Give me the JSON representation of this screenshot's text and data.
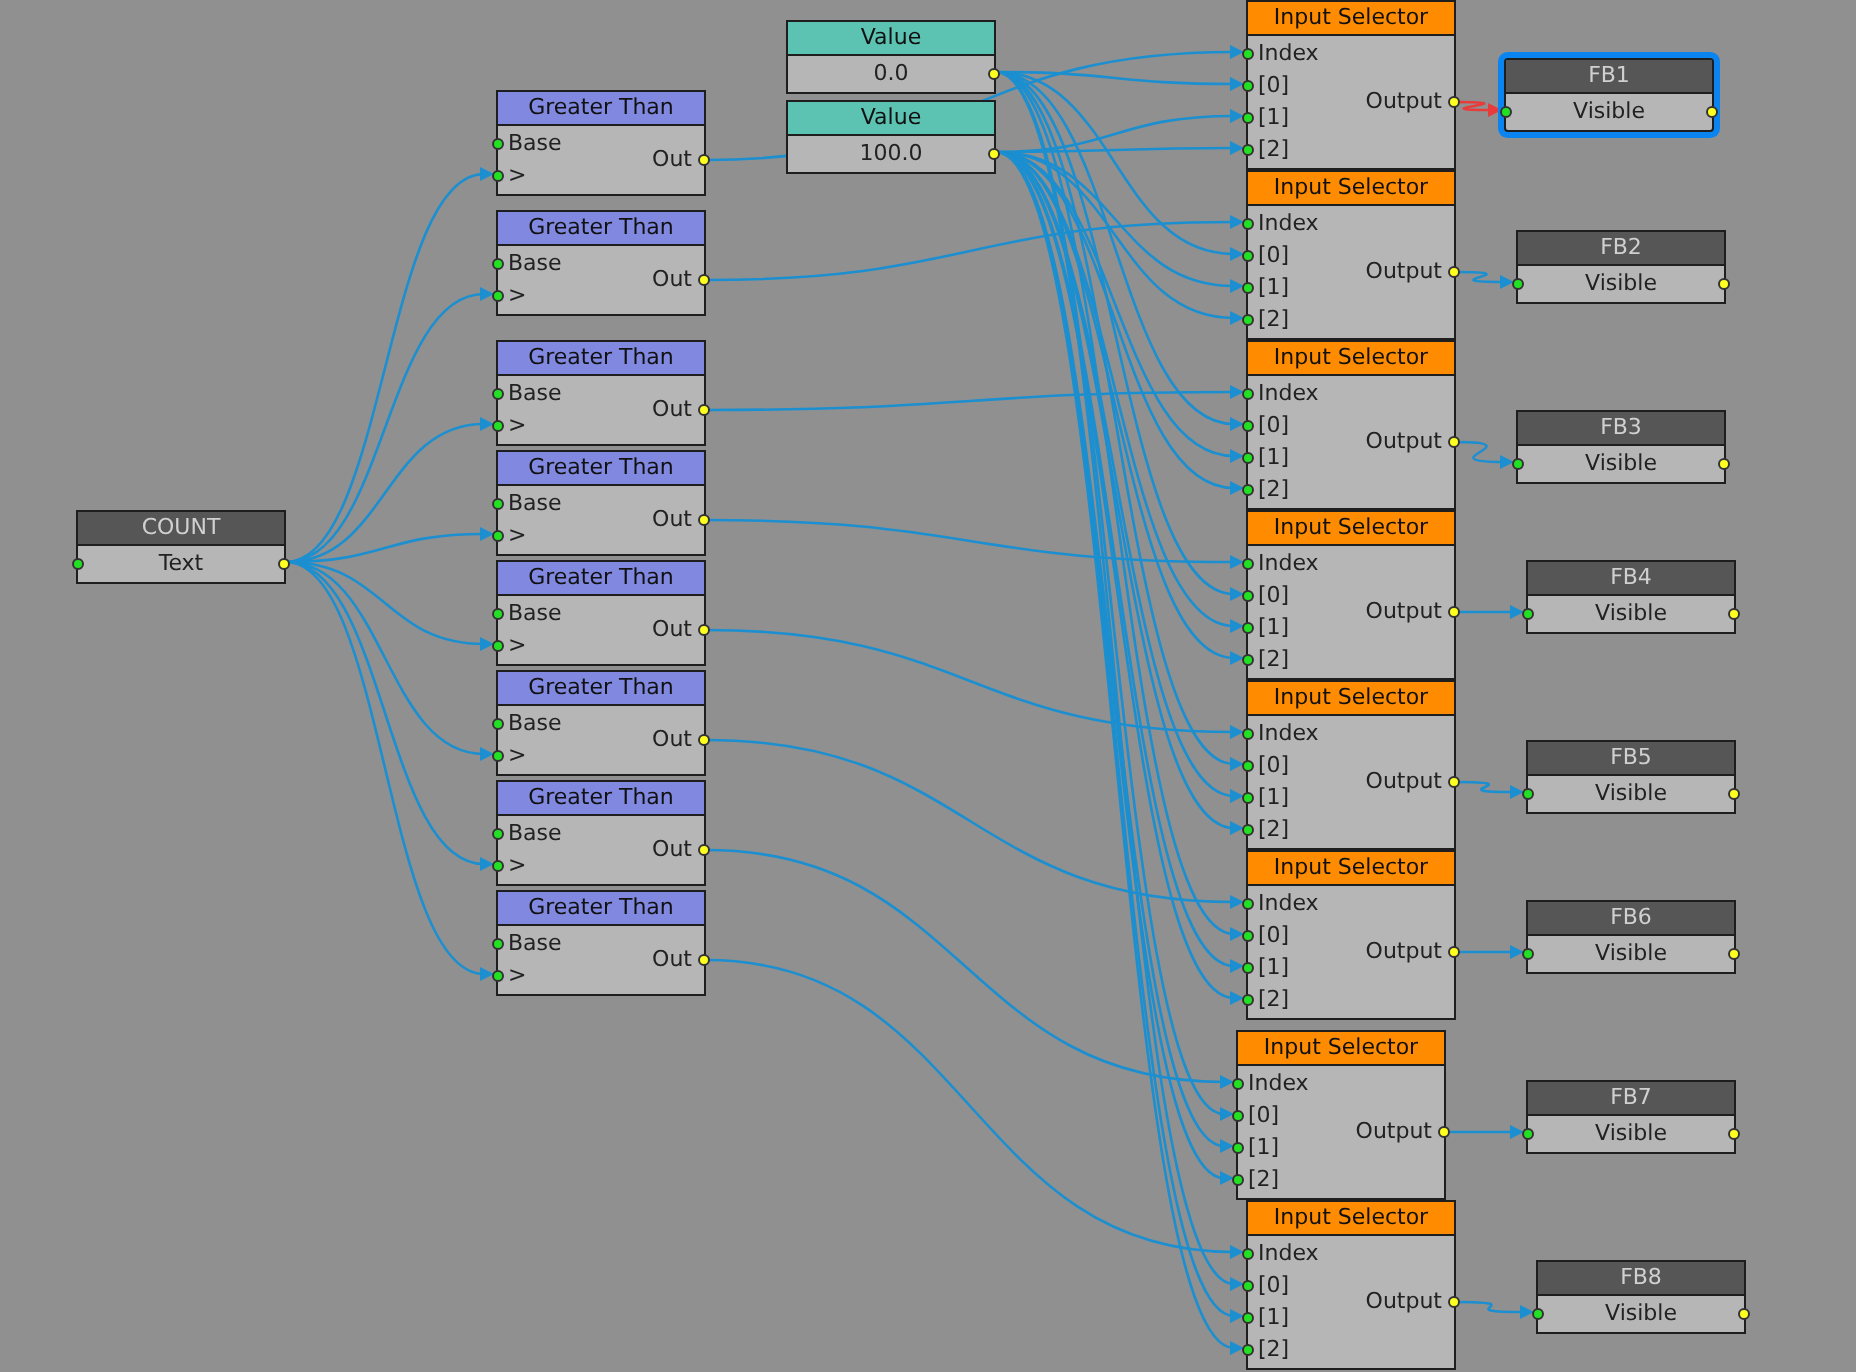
{
  "nodes": [
    {
      "kind": "source",
      "title": "COUNT",
      "field": "Text",
      "selected": false
    },
    {
      "kind": "compare",
      "title": "Greater Than",
      "inputs": [
        "Base",
        ">"
      ],
      "output": "Out",
      "selected": false
    },
    {
      "kind": "compare",
      "title": "Greater Than",
      "inputs": [
        "Base",
        ">"
      ],
      "output": "Out",
      "selected": false
    },
    {
      "kind": "compare",
      "title": "Greater Than",
      "inputs": [
        "Base",
        ">"
      ],
      "output": "Out",
      "selected": false
    },
    {
      "kind": "compare",
      "title": "Greater Than",
      "inputs": [
        "Base",
        ">"
      ],
      "output": "Out",
      "selected": false
    },
    {
      "kind": "compare",
      "title": "Greater Than",
      "inputs": [
        "Base",
        ">"
      ],
      "output": "Out",
      "selected": false
    },
    {
      "kind": "compare",
      "title": "Greater Than",
      "inputs": [
        "Base",
        ">"
      ],
      "output": "Out",
      "selected": false
    },
    {
      "kind": "compare",
      "title": "Greater Than",
      "inputs": [
        "Base",
        ">"
      ],
      "output": "Out",
      "selected": false
    },
    {
      "kind": "compare",
      "title": "Greater Than",
      "inputs": [
        "Base",
        ">"
      ],
      "output": "Out",
      "selected": false
    },
    {
      "kind": "value",
      "title": "Value",
      "field": "0.0",
      "selected": false
    },
    {
      "kind": "value",
      "title": "Value",
      "field": "100.0",
      "selected": false
    },
    {
      "kind": "selector",
      "title": "Input Selector",
      "inputs": [
        "Index",
        "[0]",
        "[1]",
        "[2]"
      ],
      "output": "Output",
      "selected": false
    },
    {
      "kind": "selector",
      "title": "Input Selector",
      "inputs": [
        "Index",
        "[0]",
        "[1]",
        "[2]"
      ],
      "output": "Output",
      "selected": false
    },
    {
      "kind": "selector",
      "title": "Input Selector",
      "inputs": [
        "Index",
        "[0]",
        "[1]",
        "[2]"
      ],
      "output": "Output",
      "selected": false
    },
    {
      "kind": "selector",
      "title": "Input Selector",
      "inputs": [
        "Index",
        "[0]",
        "[1]",
        "[2]"
      ],
      "output": "Output",
      "selected": false
    },
    {
      "kind": "selector",
      "title": "Input Selector",
      "inputs": [
        "Index",
        "[0]",
        "[1]",
        "[2]"
      ],
      "output": "Output",
      "selected": false
    },
    {
      "kind": "selector",
      "title": "Input Selector",
      "inputs": [
        "Index",
        "[0]",
        "[1]",
        "[2]"
      ],
      "output": "Output",
      "selected": false
    },
    {
      "kind": "selector",
      "title": "Input Selector",
      "inputs": [
        "Index",
        "[0]",
        "[1]",
        "[2]"
      ],
      "output": "Output",
      "selected": false
    },
    {
      "kind": "selector",
      "title": "Input Selector",
      "inputs": [
        "Index",
        "[0]",
        "[1]",
        "[2]"
      ],
      "output": "Output",
      "selected": false
    },
    {
      "kind": "target",
      "title": "FB1",
      "field": "Visible",
      "selected": true
    },
    {
      "kind": "target",
      "title": "FB2",
      "field": "Visible",
      "selected": false
    },
    {
      "kind": "target",
      "title": "FB3",
      "field": "Visible",
      "selected": false
    },
    {
      "kind": "target",
      "title": "FB4",
      "field": "Visible",
      "selected": false
    },
    {
      "kind": "target",
      "title": "FB5",
      "field": "Visible",
      "selected": false
    },
    {
      "kind": "target",
      "title": "FB6",
      "field": "Visible",
      "selected": false
    },
    {
      "kind": "target",
      "title": "FB7",
      "field": "Visible",
      "selected": false
    },
    {
      "kind": "target",
      "title": "FB8",
      "field": "Visible",
      "selected": false
    }
  ]
}
